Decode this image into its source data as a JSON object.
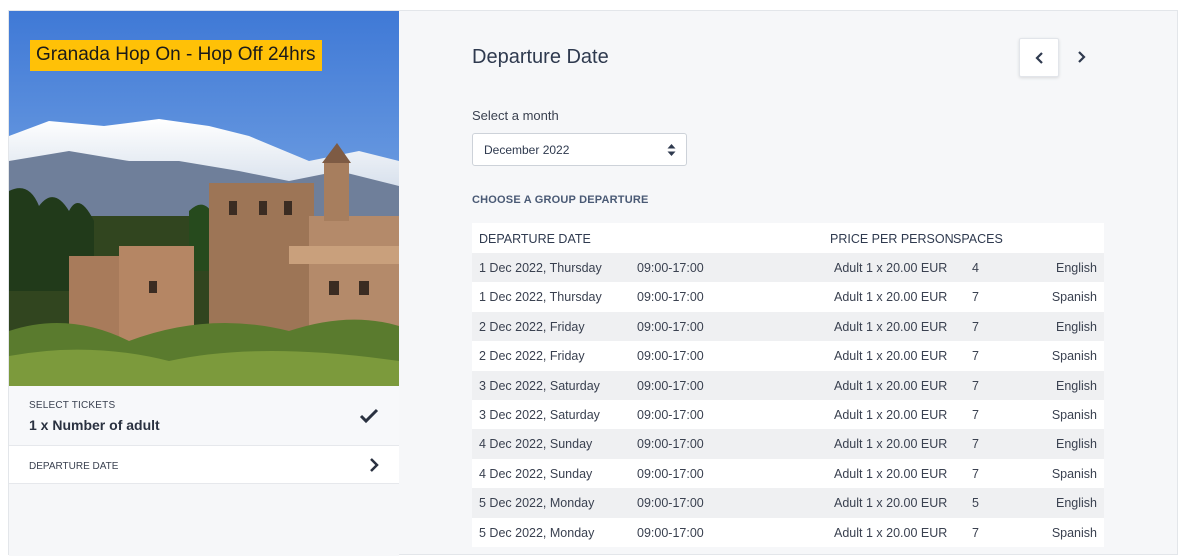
{
  "tour": {
    "title": "Granada Hop On - Hop Off 24hrs"
  },
  "tickets": {
    "caption": "SELECT TICKETS",
    "value": "1 x Number of adult"
  },
  "departure_panel": {
    "caption": "DEPARTURE DATE"
  },
  "main": {
    "title": "Departure Date",
    "select_label": "Select a month",
    "month_selected": "December 2022",
    "group_caption": "CHOOSE A GROUP DEPARTURE"
  },
  "table": {
    "headers": {
      "date": "DEPARTURE DATE",
      "price": "PRICE PER PERSON",
      "spaces": "SPACES"
    },
    "rows": [
      {
        "date": "1 Dec 2022, Thursday",
        "time": "09:00-17:00",
        "price": "Adult 1 x 20.00 EUR",
        "spaces": "4",
        "language": "English"
      },
      {
        "date": "1 Dec 2022, Thursday",
        "time": "09:00-17:00",
        "price": "Adult 1 x 20.00 EUR",
        "spaces": "7",
        "language": "Spanish"
      },
      {
        "date": "2 Dec 2022, Friday",
        "time": "09:00-17:00",
        "price": "Adult 1 x 20.00 EUR",
        "spaces": "7",
        "language": "English"
      },
      {
        "date": "2 Dec 2022, Friday",
        "time": "09:00-17:00",
        "price": "Adult 1 x 20.00 EUR",
        "spaces": "7",
        "language": "Spanish"
      },
      {
        "date": "3 Dec 2022, Saturday",
        "time": "09:00-17:00",
        "price": "Adult 1 x 20.00 EUR",
        "spaces": "7",
        "language": "English"
      },
      {
        "date": "3 Dec 2022, Saturday",
        "time": "09:00-17:00",
        "price": "Adult 1 x 20.00 EUR",
        "spaces": "7",
        "language": "Spanish"
      },
      {
        "date": "4 Dec 2022, Sunday",
        "time": "09:00-17:00",
        "price": "Adult 1 x 20.00 EUR",
        "spaces": "7",
        "language": "English"
      },
      {
        "date": "4 Dec 2022, Sunday",
        "time": "09:00-17:00",
        "price": "Adult 1 x 20.00 EUR",
        "spaces": "7",
        "language": "Spanish"
      },
      {
        "date": "5 Dec 2022, Monday",
        "time": "09:00-17:00",
        "price": "Adult 1 x 20.00 EUR",
        "spaces": "5",
        "language": "English"
      },
      {
        "date": "5 Dec 2022, Monday",
        "time": "09:00-17:00",
        "price": "Adult 1 x 20.00 EUR",
        "spaces": "7",
        "language": "Spanish"
      }
    ]
  },
  "icons": {
    "check": "check-icon",
    "chevron_right": "chevron-right-icon",
    "prev": "chevron-left-icon",
    "next": "chevron-right-icon",
    "select_arrows": "sort-arrows-icon"
  },
  "colors": {
    "badge": "#ffc107",
    "accent": "#4a5a75",
    "row_stripe": "#eff0f2",
    "panel_bg": "#f6f7f9"
  }
}
